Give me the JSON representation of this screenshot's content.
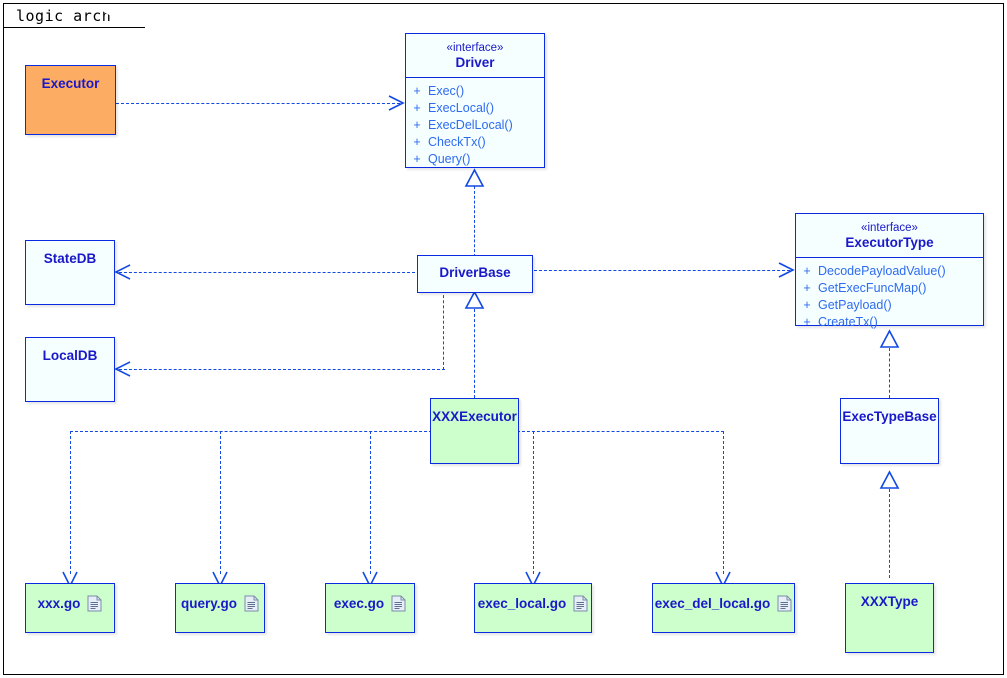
{
  "frame": {
    "label": "logic arch"
  },
  "colors": {
    "border": "#0A2BE2",
    "line": "#1149E4",
    "title_text": "#1A18C8",
    "op_text": "#2F6BEF",
    "fill_pale": "#F5FFFF",
    "fill_green": "#CCFFCC",
    "fill_orange": "#FCAC63"
  },
  "nodes": {
    "executor": {
      "name": "Executor",
      "fill": "orange"
    },
    "statedb": {
      "name": "StateDB",
      "fill": "pale"
    },
    "localdb": {
      "name": "LocalDB",
      "fill": "pale"
    },
    "driverbase": {
      "name": "DriverBase",
      "fill": "pale"
    },
    "xxxexecutor": {
      "name": "XXXExecutor",
      "fill": "green"
    },
    "exectypebase": {
      "name": "ExecTypeBase",
      "fill": "pale"
    },
    "xxxtype": {
      "name": "XXXType",
      "fill": "green"
    }
  },
  "interfaces": {
    "driver": {
      "stereotype": "«interface»",
      "name": "Driver",
      "operations": [
        {
          "visibility": "+",
          "name": "Exec()"
        },
        {
          "visibility": "+",
          "name": "ExecLocal()"
        },
        {
          "visibility": "+",
          "name": "ExecDelLocal()"
        },
        {
          "visibility": "+",
          "name": "CheckTx()"
        },
        {
          "visibility": "+",
          "name": "Query()"
        }
      ]
    },
    "executortype": {
      "stereotype": "«interface»",
      "name": "ExecutorType",
      "operations": [
        {
          "visibility": "+",
          "name": "DecodePayloadValue()"
        },
        {
          "visibility": "+",
          "name": "GetExecFuncMap()"
        },
        {
          "visibility": "+",
          "name": "GetPayload()"
        },
        {
          "visibility": "+",
          "name": "CreateTx()"
        }
      ]
    }
  },
  "files": [
    {
      "name": "xxx.go",
      "icon": "document-icon"
    },
    {
      "name": "query.go",
      "icon": "document-icon"
    },
    {
      "name": "exec.go",
      "icon": "document-icon"
    },
    {
      "name": "exec_local.go",
      "icon": "document-icon"
    },
    {
      "name": "exec_del_local.go",
      "icon": "document-icon"
    }
  ]
}
